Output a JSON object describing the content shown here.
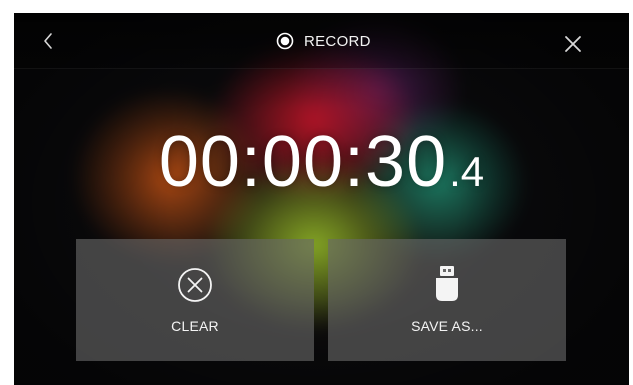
{
  "header": {
    "title": "RECORD",
    "icons": {
      "back": "chevron-left-icon",
      "record": "record-icon",
      "close": "close-icon"
    }
  },
  "timer": {
    "main": "00:00:30",
    "fraction": ".4"
  },
  "actions": [
    {
      "label": "CLEAR",
      "icon": "clear-circle-x-icon"
    },
    {
      "label": "SAVE AS...",
      "icon": "usb-drive-icon"
    }
  ],
  "colors": {
    "text": "#ffffff",
    "tile_bg": "#696969"
  }
}
